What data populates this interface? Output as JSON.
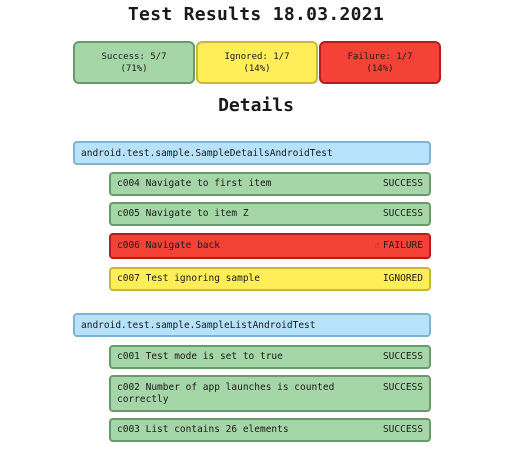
{
  "title": "Test Results 18.03.2021",
  "summary": {
    "success": {
      "line1": "Success: 5/7",
      "line2": "(71%)"
    },
    "ignored": {
      "line1": "Ignored: 1/7",
      "line2": "(14%)"
    },
    "failure": {
      "line1": "Failure: 1/7",
      "line2": "(14%)"
    }
  },
  "details_heading": "Details",
  "colors": {
    "success_bg": "#a5d6a7",
    "success_border": "#6a9a6c",
    "ignored_bg": "#ffee58",
    "ignored_border": "#c8b83a",
    "failure_bg": "#f44336",
    "failure_border": "#b71c1c",
    "suite_bg": "#b6e2fb"
  },
  "suites": [
    {
      "name": "android.test.sample.SampleDetailsAndroidTest",
      "tests": [
        {
          "name": "c004 Navigate to first item",
          "status": "SUCCESS"
        },
        {
          "name": "c005 Navigate to item Z",
          "status": "SUCCESS"
        },
        {
          "name": "c006 Navigate back",
          "status": "FAILURE"
        },
        {
          "name": "c007 Test ignoring sample",
          "status": "IGNORED"
        }
      ]
    },
    {
      "name": "android.test.sample.SampleListAndroidTest",
      "tests": [
        {
          "name": "c001 Test mode is set to true",
          "status": "SUCCESS"
        },
        {
          "name": "c002 Number of app launches is counted correctly",
          "status": "SUCCESS"
        },
        {
          "name": "c003 List contains 26 elements",
          "status": "SUCCESS"
        }
      ]
    }
  ]
}
